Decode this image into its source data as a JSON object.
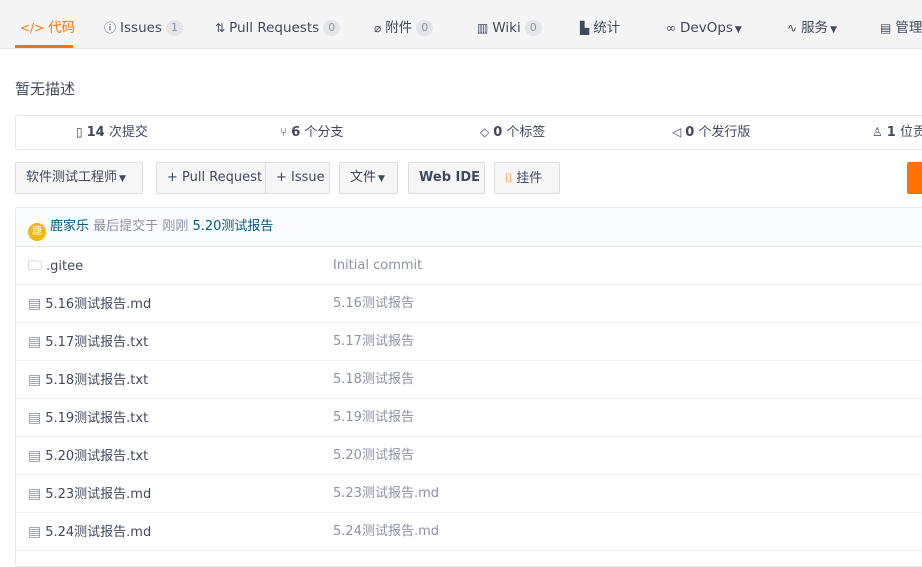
{
  "tabs": [
    {
      "label": "代码",
      "icon": "code-icon",
      "active": true
    },
    {
      "label": "Issues",
      "icon": "issue-icon",
      "badge": "1"
    },
    {
      "label": "Pull Requests",
      "icon": "pull-request-icon",
      "badge": "0"
    },
    {
      "label": "附件",
      "icon": "paperclip-icon",
      "badge": "0"
    },
    {
      "label": "Wiki",
      "icon": "book-icon",
      "badge": "0"
    },
    {
      "label": "统计",
      "icon": "chart-icon"
    },
    {
      "label": "DevOps",
      "icon": "infinity-icon"
    },
    {
      "label": "服务",
      "icon": "pulse-icon"
    },
    {
      "label": "管理",
      "icon": "settings-doc-icon"
    }
  ],
  "description": "暂无描述",
  "stats": {
    "commits": {
      "count": "14",
      "label": "次提交"
    },
    "branches": {
      "count": "6",
      "label": "个分支"
    },
    "tags": {
      "count": "0",
      "label": "个标签"
    },
    "releases": {
      "count": "0",
      "label": "个发行版"
    },
    "contributors": {
      "count": "1",
      "label": "位贡献者"
    }
  },
  "toolbar": {
    "branch": "软件测试工程师",
    "pull_request": "+ Pull Request",
    "issue": "+ Issue",
    "file": "文件",
    "web_ide": "Web IDE",
    "widget": "挂件"
  },
  "commit": {
    "avatar": "鹿",
    "author": "鹿家乐",
    "label": "最后提交于",
    "time": "刚刚",
    "message": "5.20测试报告"
  },
  "files": [
    {
      "name": ".gitee",
      "type": "folder",
      "message": "Initial commit"
    },
    {
      "name": "5.16测试报告.md",
      "type": "file",
      "message": "5.16测试报告"
    },
    {
      "name": "5.17测试报告.txt",
      "type": "file",
      "message": "5.17测试报告"
    },
    {
      "name": "5.18测试报告.txt",
      "type": "file",
      "message": "5.18测试报告"
    },
    {
      "name": "5.19测试报告.txt",
      "type": "file",
      "message": "5.19测试报告"
    },
    {
      "name": "5.20测试报告.txt",
      "type": "file",
      "message": "5.20测试报告"
    },
    {
      "name": "5.23测试报告.md",
      "type": "file",
      "message": "5.23测试报告.md"
    },
    {
      "name": "5.24测试报告.md",
      "type": "file",
      "message": "5.24测试报告.md"
    }
  ],
  "colors": {
    "accent": "#fe7300",
    "link": "#005980"
  }
}
